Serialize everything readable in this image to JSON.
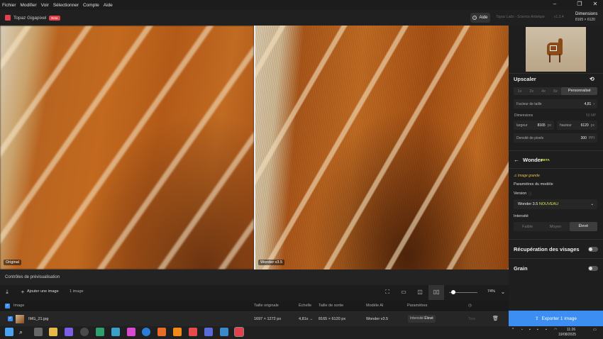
{
  "menu": [
    "Fichier",
    "Modifier",
    "Voir",
    "Sélectionner",
    "Compte",
    "Aide"
  ],
  "titlebar": {
    "app_name": "Topaz Gigapixel",
    "badge": "Beta",
    "help_label": "Aide",
    "file_title": "Topaz Labs - Science Antelope",
    "version": "v1.3.4",
    "dimensions_label": "Dimensions",
    "dimensions_value": "8165 × 6120"
  },
  "preview": {
    "left_label": "Original",
    "right_label": "Wonder v3.5"
  },
  "upscaler": {
    "title": "Upscaler",
    "scale_options": [
      "1x",
      "2x",
      "4x",
      "6x"
    ],
    "scale_custom": "Personnalisé",
    "size_factor_label": "Facteur de taille",
    "size_factor_value": "4,81",
    "dimensions_label": "Dimensions",
    "dimensions_mp": "50 MP",
    "width_label": "largeur",
    "width_value": "8165",
    "width_unit": "px",
    "height_label": "hauteur",
    "height_value": "6120",
    "height_unit": "px",
    "density_label": "Densité de pixels",
    "density_value": "300",
    "density_unit": "PPI"
  },
  "model": {
    "name": "Wonder",
    "beta": "BETA",
    "warning": "Image grande",
    "params_title": "Paramètres du modèle",
    "version_label": "Version",
    "version_value": "Wonder 3.5",
    "version_new": "NOUVEAU",
    "intensity_label": "Intensité",
    "intensity_options": [
      "Faible",
      "Moyen",
      "Élevé"
    ]
  },
  "face_recovery": "Récupération des visages",
  "grain": "Grain",
  "export_label": "Exporter 1 image",
  "controls_title": "Contrôles de prévisualisation",
  "toolbar": {
    "add_image": "Ajouter une image",
    "count": "1 image",
    "zoom": "74%"
  },
  "table": {
    "headers": [
      "Image",
      "Taille originale",
      "Échelle",
      "Taille de sortie",
      "Modèle AI",
      "Paramètres"
    ],
    "row": {
      "name": "IMG_21.jpg",
      "original": "1697 × 1272 px",
      "scale": "4,81x →",
      "output": "8165 × 6120 px",
      "model": "Wonder v3.5",
      "params_label": "Intensité",
      "params_value": "Élevé",
      "status": "Test"
    }
  },
  "taskbar": {
    "lang": "FRA",
    "time": "11:26",
    "date": "19/08/2025"
  }
}
